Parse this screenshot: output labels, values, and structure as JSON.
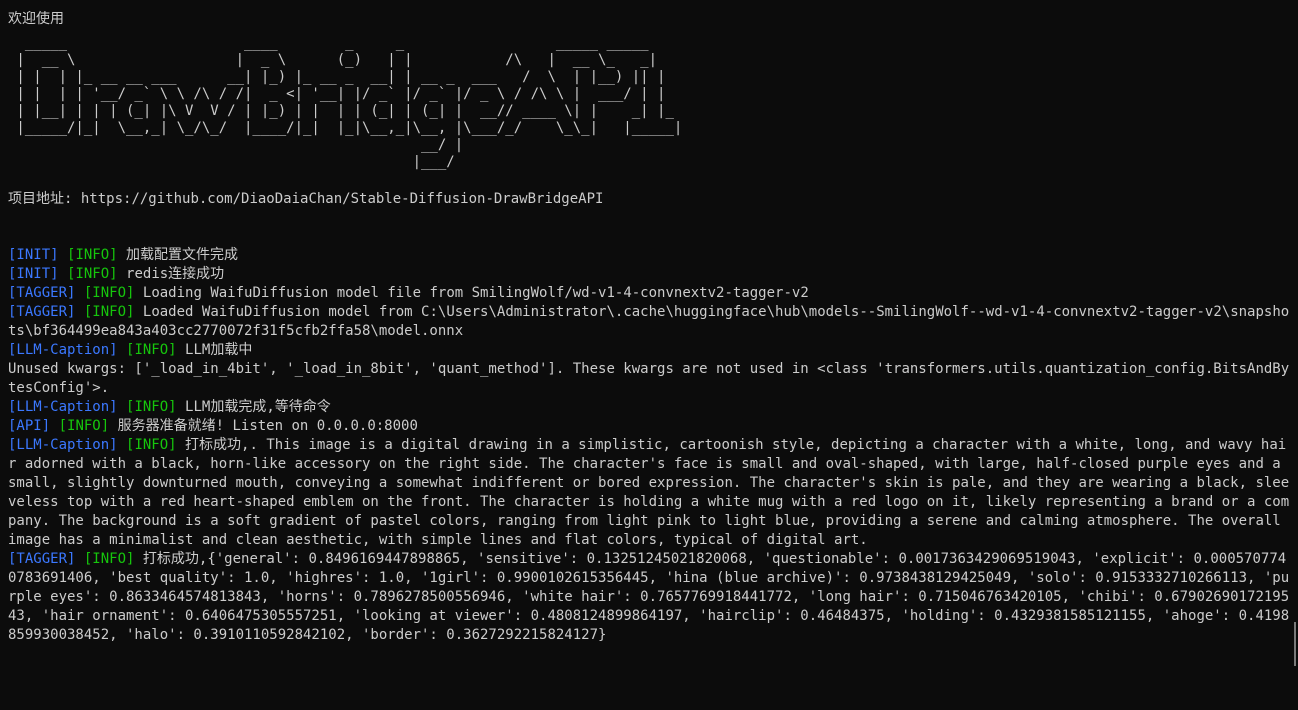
{
  "welcome": "欢迎使用",
  "banner": [
    "  _____                     ____        _     _                  _____ _____",
    " |  __ \\                   |  _ \\      (_)   | |           /\\   |  __ \\_   _|",
    " | |  | |_ __ __ ___      __| |_) |_ __ _  __| | __ _  ___   /  \\  | |__) || |",
    " | |  | | '__/ _` \\ \\ /\\ / /|  _ <| '__| |/ _` |/ _` |/ _ \\ / /\\ \\ |  ___/ | |",
    " | |__| | | | (_| |\\ V  V / | |_) | |  | | (_| | (_| |  __// ____ \\| |    _| |_",
    " |_____/|_|  \\__,_| \\_/\\_/  |____/|_|  |_|\\__,_|\\__, |\\___/_/    \\_\\_|   |_____|",
    "                                                 __/ |",
    "                                                |___/"
  ],
  "project_label": "项目地址:",
  "project_url": "https://github.com/DiaoDaiaChan/Stable-Diffusion-DrawBridgeAPI",
  "logs": [
    {
      "tag": "[INIT]",
      "level": "[INFO]",
      "message": "加载配置文件完成"
    },
    {
      "tag": "[INIT]",
      "level": "[INFO]",
      "message": "redis连接成功"
    },
    {
      "tag": "[TAGGER]",
      "level": "[INFO]",
      "message": "Loading WaifuDiffusion model file from SmilingWolf/wd-v1-4-convnextv2-tagger-v2"
    },
    {
      "tag": "[TAGGER]",
      "level": "[INFO]",
      "message": "Loaded WaifuDiffusion model from C:\\Users\\Administrator\\.cache\\huggingface\\hub\\models--SmilingWolf--wd-v1-4-convnextv2-tagger-v2\\snapshots\\bf364499ea843a403cc2770072f31f5cfb2ffa58\\model.onnx"
    },
    {
      "tag": "[LLM-Caption]",
      "level": "[INFO]",
      "message": "LLM加载中"
    },
    {
      "tag": "",
      "level": "",
      "message": "Unused kwargs: ['_load_in_4bit', '_load_in_8bit', 'quant_method']. These kwargs are not used in <class 'transformers.utils.quantization_config.BitsAndBytesConfig'>."
    },
    {
      "tag": "[LLM-Caption]",
      "level": "[INFO]",
      "message": "LLM加载完成,等待命令"
    },
    {
      "tag": "[API]",
      "level": "[INFO]",
      "message": "服务器准备就绪! Listen on 0.0.0.0:8000"
    },
    {
      "tag": "[LLM-Caption]",
      "level": "[INFO]",
      "message": "打标成功,. This image is a digital drawing in a simplistic, cartoonish style, depicting a character with a white, long, and wavy hair adorned with a black, horn-like accessory on the right side. The character's face is small and oval-shaped, with large, half-closed purple eyes and a small, slightly downturned mouth, conveying a somewhat indifferent or bored expression. The character's skin is pale, and they are wearing a black, sleeveless top with a red heart-shaped emblem on the front. The character is holding a white mug with a red logo on it, likely representing a brand or a company. The background is a soft gradient of pastel colors, ranging from light pink to light blue, providing a serene and calming atmosphere. The overall image has a minimalist and clean aesthetic, with simple lines and flat colors, typical of digital art."
    },
    {
      "tag": "[TAGGER]",
      "level": "[INFO]",
      "message": "打标成功,{'general': 0.8496169447898865, 'sensitive': 0.13251245021820068, 'questionable': 0.0017363429069519043, 'explicit': 0.0005707740783691406, 'best quality': 1.0, 'highres': 1.0, '1girl': 0.9900102615356445, 'hina (blue archive)': 0.9738438129425049, 'solo': 0.9153332710266113, 'purple eyes': 0.8633464574813843, 'horns': 0.7896278500556946, 'white hair': 0.7657769918441772, 'long hair': 0.715046763420105, 'chibi': 0.6790269017219543, 'hair ornament': 0.6406475305557251, 'looking at viewer': 0.4808124899864197, 'hairclip': 0.46484375, 'holding': 0.4329381585121155, 'ahoge': 0.4198859930038452, 'halo': 0.3910110592842102, 'border': 0.3627292215824127}"
    }
  ],
  "colors": {
    "background": "#0c0c0c",
    "foreground": "#cccccc",
    "tag": "#3b78ff",
    "level": "#16c60c"
  }
}
